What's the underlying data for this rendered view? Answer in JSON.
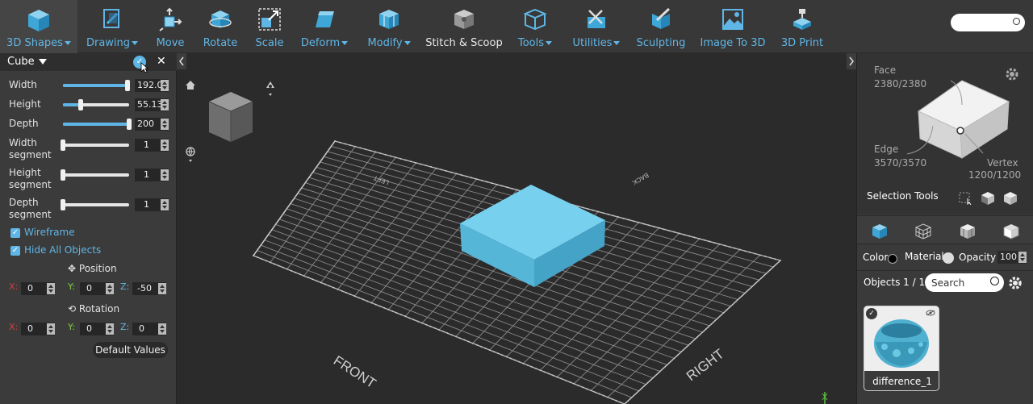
{
  "toolbar": {
    "items": [
      {
        "id": "3d-shapes",
        "label": "3D Shapes",
        "dropdown": true,
        "icon": "cube-icon"
      },
      {
        "id": "drawing",
        "label": "Drawing",
        "dropdown": true,
        "icon": "drawing-icon"
      },
      {
        "id": "move",
        "label": "Move",
        "dropdown": false,
        "icon": "move-icon"
      },
      {
        "id": "rotate",
        "label": "Rotate",
        "dropdown": false,
        "icon": "rotate-icon"
      },
      {
        "id": "scale",
        "label": "Scale",
        "dropdown": false,
        "icon": "scale-icon"
      },
      {
        "id": "deform",
        "label": "Deform",
        "dropdown": true,
        "icon": "deform-icon"
      },
      {
        "id": "modify",
        "label": "Modify",
        "dropdown": true,
        "icon": "modify-icon"
      },
      {
        "id": "stitch",
        "label": "Stitch & Scoop",
        "dropdown": false,
        "icon": "stitch-scoop-icon"
      },
      {
        "id": "tools",
        "label": "Tools",
        "dropdown": true,
        "icon": "tools-icon"
      },
      {
        "id": "utilities",
        "label": "Utilities",
        "dropdown": true,
        "icon": "utilities-icon"
      },
      {
        "id": "sculpting",
        "label": "Sculpting",
        "dropdown": false,
        "icon": "sculpting-icon"
      },
      {
        "id": "image-to-3d",
        "label": "Image To 3D",
        "dropdown": false,
        "icon": "image-icon"
      },
      {
        "id": "3d-print",
        "label": "3D Print",
        "dropdown": false,
        "icon": "printer-icon"
      }
    ],
    "search_placeholder": ""
  },
  "left_panel": {
    "title": "Cube",
    "params": [
      {
        "label": "Width",
        "value": "192.04",
        "fraction": 0.97
      },
      {
        "label": "Height",
        "value": "55.13",
        "fraction": 0.27
      },
      {
        "label": "Depth",
        "value": "200",
        "fraction": 1.0
      },
      {
        "label": "Width\nsegment",
        "value": "1",
        "fraction": 0
      },
      {
        "label": "Height\nsegment",
        "value": "1",
        "fraction": 0
      },
      {
        "label": "Depth\nsegment",
        "value": "1",
        "fraction": 0
      }
    ],
    "wireframe_label": "Wireframe",
    "hide_all_label": "Hide All Objects",
    "position_label": "Position",
    "rotation_label": "Rotation",
    "position": {
      "x": "0",
      "y": "0",
      "z": "-50"
    },
    "rotation": {
      "x": "0",
      "y": "0",
      "z": "0"
    },
    "axis_labels": {
      "x": "X:",
      "y": "Y:",
      "z": "Z:"
    },
    "default_values_label": "Default Values"
  },
  "viewport": {
    "labels": {
      "front": "FRONT",
      "right": "RIGHT",
      "left": "LEFT",
      "back": "BACK"
    },
    "cube_color": "#5ec3e3",
    "grid_color": "#8a8a8a"
  },
  "right_panel": {
    "face_label": "Face",
    "face_count": "2380/2380",
    "edge_label": "Edge",
    "edge_count": "3570/3570",
    "vertex_label": "Vertex",
    "vertex_count": "1200/1200",
    "selection_tools_label": "Selection Tools",
    "color_label": "Color",
    "material_label": "Material",
    "opacity_label": "Opacity",
    "opacity_value": "100",
    "objects_label": "Objects 1 / 1",
    "search_placeholder": "Search",
    "object_name": "difference_1"
  },
  "colors": {
    "accent": "#5fb6e6",
    "toolbar_bg": "#383838",
    "panel_bg": "#3b3b3b",
    "viewport_bg": "#2b2b2b"
  }
}
